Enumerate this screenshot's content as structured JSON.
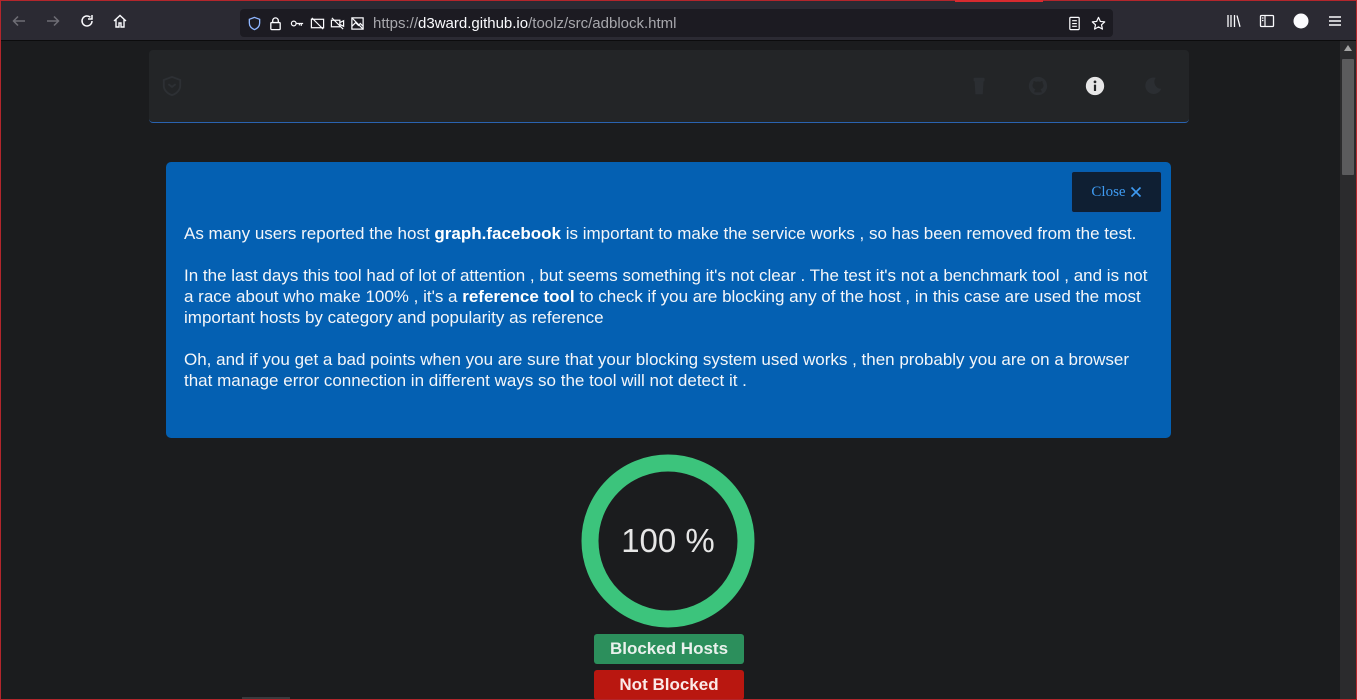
{
  "browser": {
    "url_prefix": "https://",
    "url_domain": "d3ward.github.io",
    "url_path": "/toolz/src/adblock.html",
    "icons": [
      "back-icon",
      "forward-icon",
      "reload-icon",
      "home-icon",
      "shield-icon",
      "lock-icon",
      "key-icon",
      "media-blocked-icon",
      "camera-blocked-icon",
      "image-blocked-icon",
      "reader-view-icon",
      "star-icon",
      "library-icon",
      "sidebar-icon",
      "account-icon",
      "menu-icon"
    ]
  },
  "alert": {
    "close_label": "Close",
    "p1_a": "As many users reported the host ",
    "p1_b": "graph.facebook",
    "p1_c": " is important to make the service works , so has been removed from the test.",
    "p2_a": "In the last days this tool had of lot of attention , but seems something it's not clear . The test it's not a benchmark tool , and is not a race about who make 100% , it's a ",
    "p2_b": "reference tool",
    "p2_c": " to check if you are blocking any of the host , in this case are used the most important hosts by category and popularity as reference",
    "p3": "Oh, and if you get a bad points when you are sure that your blocking system used works , then probably you are on a browser that manage error connection in different ways so the tool will not detect it ."
  },
  "score": {
    "percent": 100,
    "label": "100 %",
    "ring_color": "#3cc47c"
  },
  "badges": {
    "blocked": "Blocked Hosts",
    "not_blocked": "Not Blocked"
  },
  "colors": {
    "alert_bg": "#0460b2",
    "blocked_green": "#2c8f5c",
    "not_blocked_red": "#b91710"
  }
}
